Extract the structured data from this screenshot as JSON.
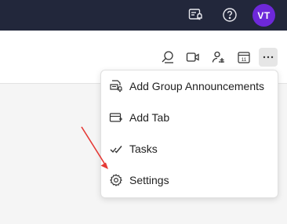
{
  "topbar": {
    "icons": [
      "announcement-bell-icon",
      "help-icon"
    ],
    "avatar_initials": "VT",
    "avatar_color": "#6d28d9",
    "background": "#22273b"
  },
  "toolbar": {
    "icons": [
      "search-icon",
      "video-icon",
      "add-person-icon",
      "calendar-icon",
      "more-icon"
    ],
    "calendar_day": "11"
  },
  "menu": {
    "items": [
      {
        "label": "Add Group Announcements",
        "icon": "announcement-icon"
      },
      {
        "label": "Add Tab",
        "icon": "add-tab-icon"
      },
      {
        "label": "Tasks",
        "icon": "tasks-icon"
      },
      {
        "label": "Settings",
        "icon": "gear-icon"
      }
    ]
  },
  "annotation": {
    "arrow_color": "#e53935"
  }
}
